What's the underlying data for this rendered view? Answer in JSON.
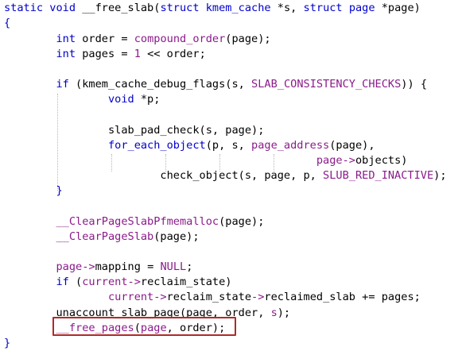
{
  "highlight_color": "#b02a2a",
  "keyword_color": "#0000cd",
  "identifier_color": "#8b1a8b",
  "lines": [
    {
      "tokens": [
        {
          "t": "static void ",
          "c": "kw"
        },
        {
          "t": "__free_slab",
          "c": "p"
        },
        {
          "t": "(",
          "c": "p"
        },
        {
          "t": "struct ",
          "c": "kw"
        },
        {
          "t": "kmem_cache ",
          "c": "type"
        },
        {
          "t": "*",
          "c": "p"
        },
        {
          "t": "s",
          "c": "p"
        },
        {
          "t": ", ",
          "c": "p"
        },
        {
          "t": "struct ",
          "c": "kw"
        },
        {
          "t": "page ",
          "c": "type"
        },
        {
          "t": "*page)",
          "c": "p"
        }
      ]
    },
    {
      "tokens": [
        {
          "t": "{",
          "c": "kw"
        }
      ]
    },
    {
      "tokens": [
        {
          "t": "        ",
          "c": "p"
        },
        {
          "t": "int ",
          "c": "kw"
        },
        {
          "t": "order ",
          "c": "p"
        },
        {
          "t": "= ",
          "c": "p"
        },
        {
          "t": "compound_order",
          "c": "op"
        },
        {
          "t": "(page);",
          "c": "p"
        }
      ]
    },
    {
      "tokens": [
        {
          "t": "        ",
          "c": "p"
        },
        {
          "t": "int ",
          "c": "kw"
        },
        {
          "t": "pages ",
          "c": "p"
        },
        {
          "t": "= ",
          "c": "p"
        },
        {
          "t": "1 ",
          "c": "num"
        },
        {
          "t": "<< order;",
          "c": "p"
        }
      ]
    },
    {
      "tokens": []
    },
    {
      "tokens": [
        {
          "t": "        ",
          "c": "p"
        },
        {
          "t": "if ",
          "c": "kw"
        },
        {
          "t": "(kmem_cache_debug_flags(s, ",
          "c": "p"
        },
        {
          "t": "SLAB_CONSISTENCY_CHECKS",
          "c": "const"
        },
        {
          "t": ")) {",
          "c": "p"
        }
      ]
    },
    {
      "tokens": [
        {
          "t": "                ",
          "c": "p"
        },
        {
          "t": "void ",
          "c": "kw"
        },
        {
          "t": "*p;",
          "c": "p"
        }
      ]
    },
    {
      "tokens": []
    },
    {
      "tokens": [
        {
          "t": "                ",
          "c": "p"
        },
        {
          "t": "slab_pad_check(s, page);",
          "c": "p"
        }
      ]
    },
    {
      "tokens": [
        {
          "t": "                ",
          "c": "p"
        },
        {
          "t": "for_each_object",
          "c": "kw"
        },
        {
          "t": "(p, s, ",
          "c": "p"
        },
        {
          "t": "page_address",
          "c": "op"
        },
        {
          "t": "(page),",
          "c": "p"
        }
      ]
    },
    {
      "tokens": [
        {
          "t": "                                                ",
          "c": "p"
        },
        {
          "t": "page",
          "c": "op"
        },
        {
          "t": "->",
          "c": "op"
        },
        {
          "t": "objects)",
          "c": "p"
        }
      ]
    },
    {
      "tokens": [
        {
          "t": "                        ",
          "c": "p"
        },
        {
          "t": "check_object(s, page, p, ",
          "c": "p"
        },
        {
          "t": "SLUB_RED_INACTIVE",
          "c": "const"
        },
        {
          "t": ");",
          "c": "p"
        }
      ]
    },
    {
      "tokens": [
        {
          "t": "        ",
          "c": "p"
        },
        {
          "t": "}",
          "c": "kw"
        }
      ]
    },
    {
      "tokens": []
    },
    {
      "tokens": [
        {
          "t": "        ",
          "c": "p"
        },
        {
          "t": "__ClearPageSlabPfmemalloc",
          "c": "op"
        },
        {
          "t": "(page);",
          "c": "p"
        }
      ]
    },
    {
      "tokens": [
        {
          "t": "        ",
          "c": "p"
        },
        {
          "t": "__ClearPageSlab",
          "c": "op"
        },
        {
          "t": "(page);",
          "c": "p"
        }
      ]
    },
    {
      "tokens": []
    },
    {
      "tokens": [
        {
          "t": "        ",
          "c": "p"
        },
        {
          "t": "page",
          "c": "op"
        },
        {
          "t": "->",
          "c": "op"
        },
        {
          "t": "mapping ",
          "c": "p"
        },
        {
          "t": "= ",
          "c": "p"
        },
        {
          "t": "NULL",
          "c": "const"
        },
        {
          "t": ";",
          "c": "p"
        }
      ]
    },
    {
      "tokens": [
        {
          "t": "        ",
          "c": "p"
        },
        {
          "t": "if ",
          "c": "kw"
        },
        {
          "t": "(",
          "c": "p"
        },
        {
          "t": "current",
          "c": "op"
        },
        {
          "t": "->",
          "c": "op"
        },
        {
          "t": "reclaim_state)",
          "c": "p"
        }
      ]
    },
    {
      "tokens": [
        {
          "t": "                ",
          "c": "p"
        },
        {
          "t": "current",
          "c": "op"
        },
        {
          "t": "->",
          "c": "op"
        },
        {
          "t": "reclaim_state",
          "c": "p"
        },
        {
          "t": "->",
          "c": "op"
        },
        {
          "t": "reclaimed_slab ",
          "c": "p"
        },
        {
          "t": "+= pages;",
          "c": "p"
        }
      ]
    },
    {
      "tokens": [
        {
          "t": "        ",
          "c": "p"
        },
        {
          "t": "unaccount_slab_page(page, order, ",
          "c": "p"
        },
        {
          "t": "s",
          "c": "op"
        },
        {
          "t": ");",
          "c": "p"
        }
      ]
    },
    {
      "tokens": [
        {
          "t": "        ",
          "c": "p"
        },
        {
          "t": "__free_pages",
          "c": "op"
        },
        {
          "t": "(",
          "c": "p"
        },
        {
          "t": "page",
          "c": "op"
        },
        {
          "t": ", order);",
          "c": "p"
        }
      ]
    },
    {
      "tokens": [
        {
          "t": "}",
          "c": "kw"
        }
      ]
    }
  ]
}
